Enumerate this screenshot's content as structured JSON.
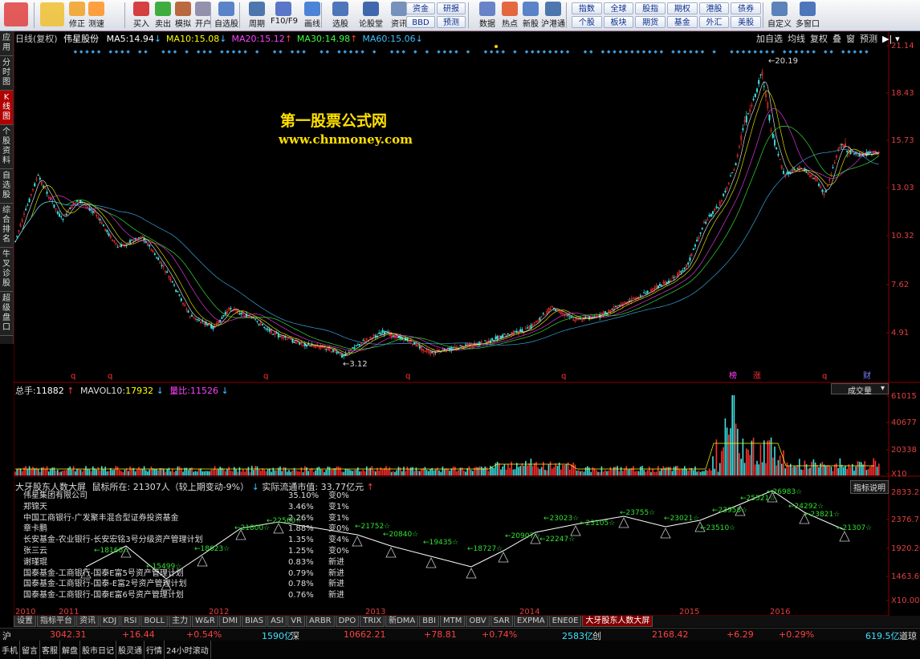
{
  "toolbar": {
    "buttons": [
      {
        "label": "",
        "icon": "app-logo-icon"
      },
      {
        "label": "",
        "icon": "back-arrow-icon"
      },
      {
        "label": "修正",
        "icon": "up-down-arrows-icon"
      },
      {
        "label": "测速",
        "icon": "clock-icon"
      },
      {
        "label": "买入",
        "icon": "buy-icon"
      },
      {
        "label": "卖出",
        "icon": "sell-icon"
      },
      {
        "label": "模拟",
        "icon": "hammer-icon"
      },
      {
        "label": "开户",
        "icon": "lock-icon"
      },
      {
        "label": "自选股",
        "icon": "star-grid-icon"
      },
      {
        "label": "周期",
        "icon": "cycle-icon"
      },
      {
        "label": "F10/F9",
        "icon": "f10-icon"
      },
      {
        "label": "画线",
        "icon": "pen-icon"
      },
      {
        "label": "选股",
        "icon": "select-stock-icon"
      },
      {
        "label": "论股堂",
        "icon": "forum-icon"
      },
      {
        "label": "资讯",
        "icon": "news-icon"
      },
      {
        "label": "数据",
        "icon": "pe-icon"
      },
      {
        "label": "热点",
        "icon": "fire-icon"
      },
      {
        "label": "新股",
        "icon": "new-stock-icon"
      },
      {
        "label": "沪港通",
        "icon": "hk-connect-icon"
      },
      {
        "label": "自定义",
        "icon": "custom-icon"
      },
      {
        "label": "多窗口",
        "icon": "multi-window-icon"
      }
    ],
    "grid1": [
      "资金",
      "研报",
      "BBD",
      "预测"
    ],
    "grid2": [
      "指数",
      "全球",
      "股指",
      "期权",
      "港股",
      "债券",
      "个股",
      "板块",
      "期货",
      "基金",
      "外汇",
      "美股"
    ]
  },
  "sidebar": [
    "应用",
    "分时图",
    "K线图",
    "个股资料",
    "自选股",
    "综合排名",
    "牛叉诊股",
    "超级盘口"
  ],
  "kline": {
    "stock": "伟星股份",
    "type": "日线(复权)",
    "ma": [
      {
        "label": "MA5:",
        "value": "14.94",
        "arrow": "↓",
        "color": "#ffffff"
      },
      {
        "label": "MA10:",
        "value": "15.08",
        "arrow": "↓",
        "color": "#ffff00"
      },
      {
        "label": "MA20:",
        "value": "15.12",
        "arrow": "↑",
        "color": "#ff40ff"
      },
      {
        "label": "MA30:",
        "value": "14.98",
        "arrow": "↑",
        "color": "#40ff40"
      },
      {
        "label": "MA60:",
        "value": "15.06",
        "arrow": "↓",
        "color": "#40c0ff"
      }
    ],
    "right_buttons": [
      "加自选",
      "均线",
      "复权",
      "叠",
      "窗",
      "预测"
    ],
    "y_ticks": [
      "21.14",
      "18.43",
      "15.73",
      "13.03",
      "10.32",
      "7.62",
      "4.91"
    ],
    "max_label": "20.19",
    "min_label": "3.12",
    "watermark_title": "第一股票公式网",
    "watermark_url": "www.chnmoney.com",
    "markers": [
      "q",
      "q",
      "q",
      "q",
      "q",
      "榜",
      "涨",
      "q",
      "财"
    ]
  },
  "volume": {
    "total_label": "总手:",
    "total": "11882",
    "mavol_label": "MAVOL10:",
    "mavol": "17932",
    "ratio_label": "量比:",
    "ratio": "11526",
    "dropdown": "成交量",
    "y_ticks": [
      "61015",
      "40677",
      "20338",
      "X10"
    ]
  },
  "holders": {
    "title": "大牙股东人数大屏",
    "mouse_label": "鼠标所在:",
    "mouse_value": "21307人（较上期变动-9%）",
    "cap_label": "实际流通市值:",
    "cap_value": "33.77亿元",
    "explain": "指标说明",
    "rows": [
      {
        "name": "伟星集团有限公司",
        "pct": "35.10%",
        "chg": "变0%"
      },
      {
        "name": "郑锦天",
        "pct": "3.46%",
        "chg": "变1%"
      },
      {
        "name": "中国工商银行-广发聚丰混合型证券投资基金",
        "pct": "2.26%",
        "chg": "变1%"
      },
      {
        "name": "章卡鹏",
        "pct": "1.88%",
        "chg": "变0%"
      },
      {
        "name": "长安基金-农业银行-长安宏铭3号分级资产管理计划",
        "pct": "1.35%",
        "chg": "变4%"
      },
      {
        "name": "张三云",
        "pct": "1.25%",
        "chg": "变0%"
      },
      {
        "name": "谢瑾琨",
        "pct": "0.83%",
        "chg": "新进"
      },
      {
        "name": "国泰基金-工商银行-国泰E富5号资产管理计划",
        "pct": "0.79%",
        "chg": "新进"
      },
      {
        "name": "国泰基金-工商银行-国泰-E富2号资产管理计划",
        "pct": "0.78%",
        "chg": "新进"
      },
      {
        "name": "国泰基金-工商银行-国泰E富6号资产管理计划",
        "pct": "0.76%",
        "chg": "新进"
      }
    ],
    "y_ticks": [
      "2833.22",
      "2376.71",
      "1920.20",
      "1463.69",
      "X10.00"
    ],
    "points": [
      "18166",
      "15499",
      "18623",
      "21800",
      "22560",
      "21752",
      "20840",
      "19435",
      "18727",
      "20907",
      "22247",
      "23023",
      "23105",
      "23755",
      "23021",
      "23510",
      "23958",
      "25521",
      "26983",
      "24292",
      "23821",
      "21307"
    ]
  },
  "years": [
    "2010",
    "2011",
    "2012",
    "2013",
    "2014",
    "2015",
    "2016"
  ],
  "tabs": [
    "设置",
    "指标平台",
    "资讯",
    "KDJ",
    "RSI",
    "BOLL",
    "主力",
    "W&R",
    "DMI",
    "BIAS",
    "ASI",
    "VR",
    "ARBR",
    "DPO",
    "TRIX",
    "新DMA",
    "BBI",
    "MTM",
    "OBV",
    "SAR",
    "EXPMA",
    "ENE0E",
    "大牙股东人数大屏"
  ],
  "status": {
    "sh_label": "沪",
    "sh_index": "3042.31",
    "sh_chg": "+16.44",
    "sh_pct": "+0.54%",
    "sh_amt": "1590亿",
    "sz_label": "深",
    "sz_index": "10662.21",
    "sz_chg": "+78.81",
    "sz_pct": "+0.74%",
    "sz_amt": "2583亿",
    "cy_label": "创",
    "cy_index": "2168.42",
    "cy_chg": "+6.29",
    "cy_pct": "+0.29%",
    "cy_amt": "619.5亿",
    "tail": "道琼"
  },
  "taskbar": [
    "手机",
    "留言",
    "客服",
    "解盘",
    "股市日记",
    "股灵通",
    "行情",
    "24小时滚动"
  ]
}
